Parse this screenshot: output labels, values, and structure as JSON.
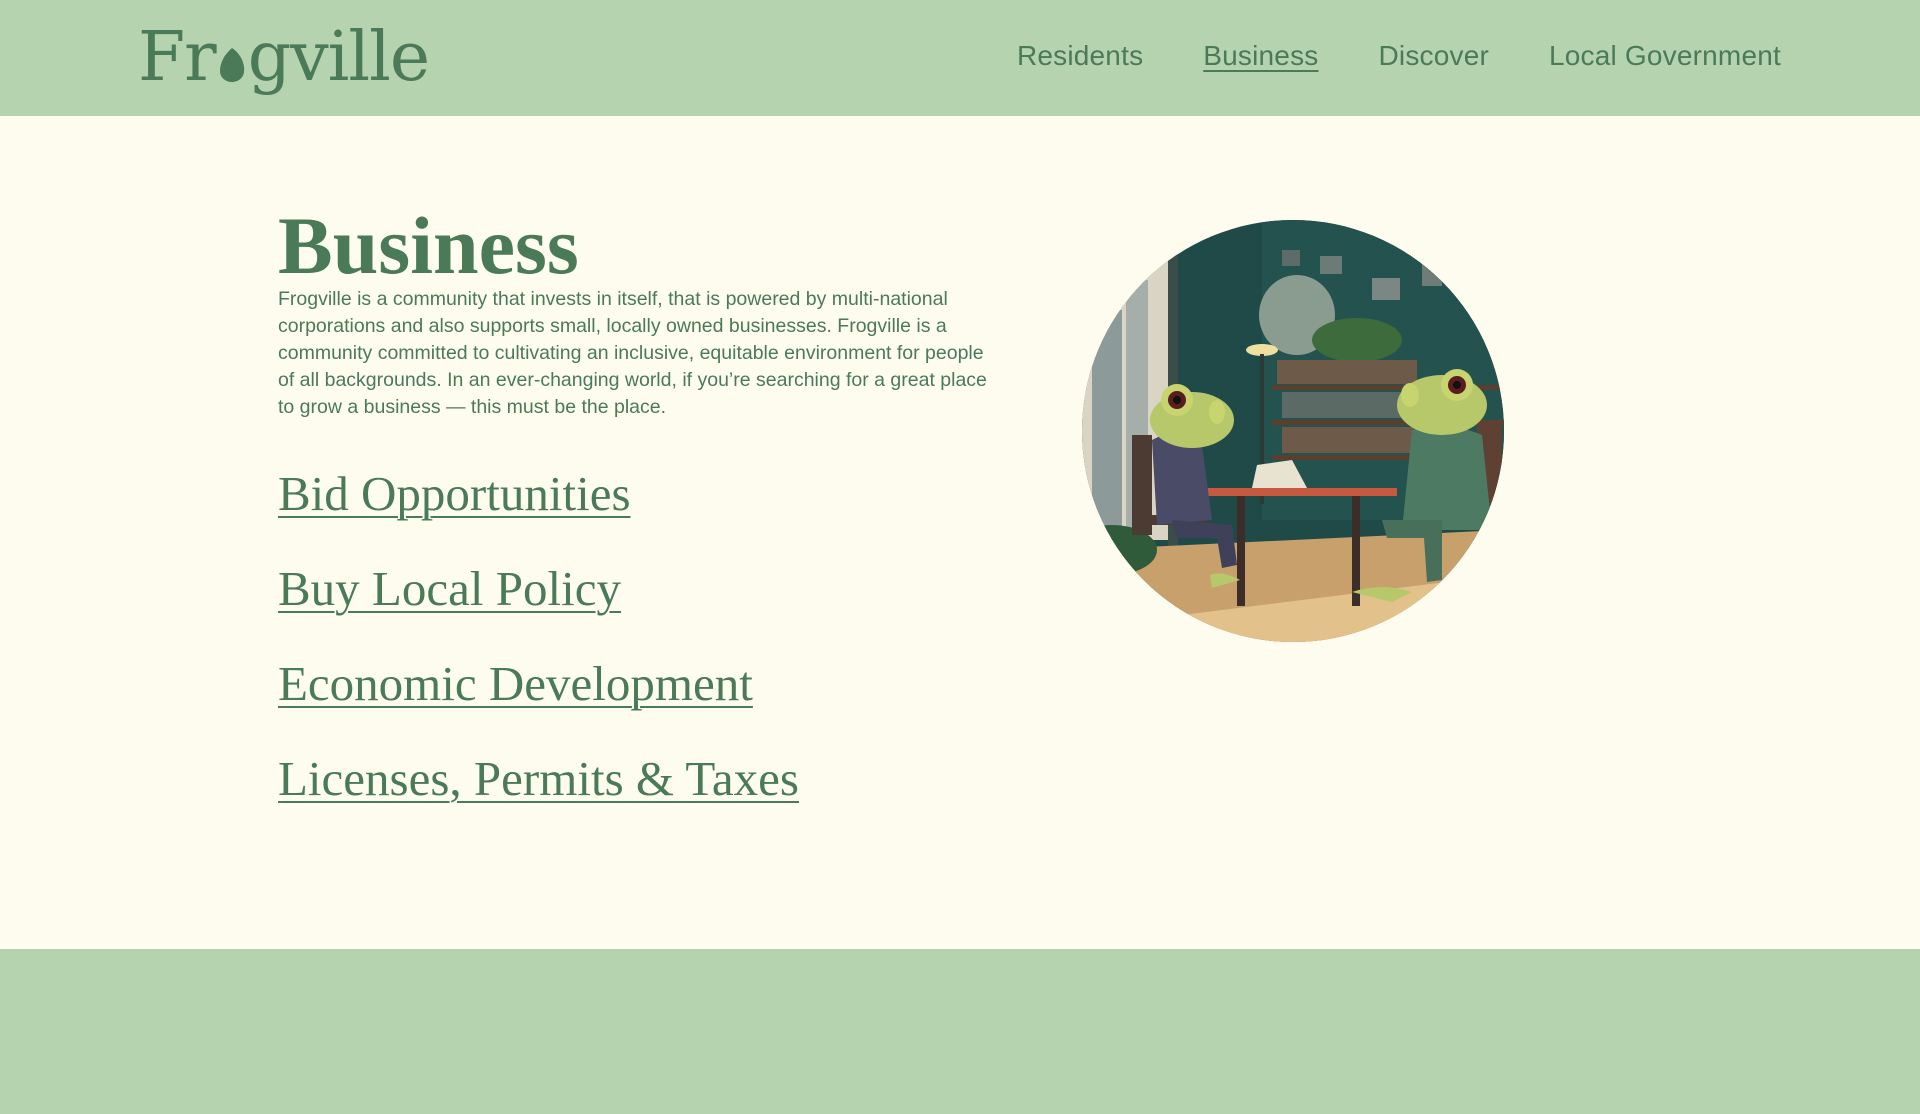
{
  "header": {
    "logo_text": "Frogville",
    "nav": [
      {
        "label": "Residents",
        "active": false
      },
      {
        "label": "Business",
        "active": true
      },
      {
        "label": "Discover",
        "active": false
      },
      {
        "label": "Local Government",
        "active": false
      }
    ]
  },
  "main": {
    "title": "Business",
    "intro": "Frogville is a community that invests in itself, that is powered by multi-national corporations and also supports small, locally owned businesses. Frogville is a community committed to cultivating an inclusive, equitable environment for people of all backgrounds. In an ever-changing world, if you’re searching for a great place to grow a business — this must be the place.",
    "links": [
      {
        "label": "Bid Opportunities"
      },
      {
        "label": "Buy Local Policy"
      },
      {
        "label": "Economic Development "
      },
      {
        "label": "Licenses, Permits & Taxes"
      }
    ]
  },
  "colors": {
    "header_bg": "#b6d3b0",
    "page_bg": "#fefcef",
    "text": "#4a7a57",
    "footer_bg": "#b6d3b0"
  },
  "icons": {
    "logo_o": "frog-egg-icon",
    "hero": "frog-business-illustration"
  }
}
